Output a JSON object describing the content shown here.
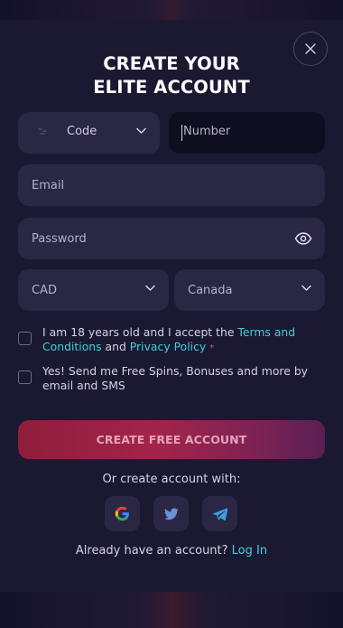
{
  "modal": {
    "title_line1": "CREATE YOUR",
    "title_line2": "ELITE ACCOUNT"
  },
  "form": {
    "code": {
      "label": "Code",
      "icon": "flag-icon"
    },
    "number": {
      "placeholder": "Number"
    },
    "email": {
      "placeholder": "Email"
    },
    "password": {
      "placeholder": "Password",
      "icon": "eye-icon"
    },
    "currency": {
      "value": "CAD"
    },
    "country": {
      "value": "Canada"
    }
  },
  "consent": {
    "terms_prefix": "I am 18 years old and I accept the ",
    "terms_link": "Terms and Conditions",
    "terms_and": " and ",
    "privacy_link": "Privacy Policy",
    "required_mark": "*",
    "marketing_text": "Yes! Send me Free Spins, Bonuses and more by email and SMS"
  },
  "cta": {
    "label": "CREATE FREE ACCOUNT"
  },
  "social": {
    "prompt": "Or create account with:",
    "providers": [
      "google-icon",
      "twitter-icon",
      "telegram-icon"
    ]
  },
  "login": {
    "prompt": "Already have an account? ",
    "link": "Log In"
  },
  "colors": {
    "background": "#0f0d20",
    "modal": "#1b1832",
    "field": "#2a2744",
    "accent_link": "#3fd0d6",
    "cta_start": "#8f1d3b",
    "cta_end": "#5a1f52"
  }
}
